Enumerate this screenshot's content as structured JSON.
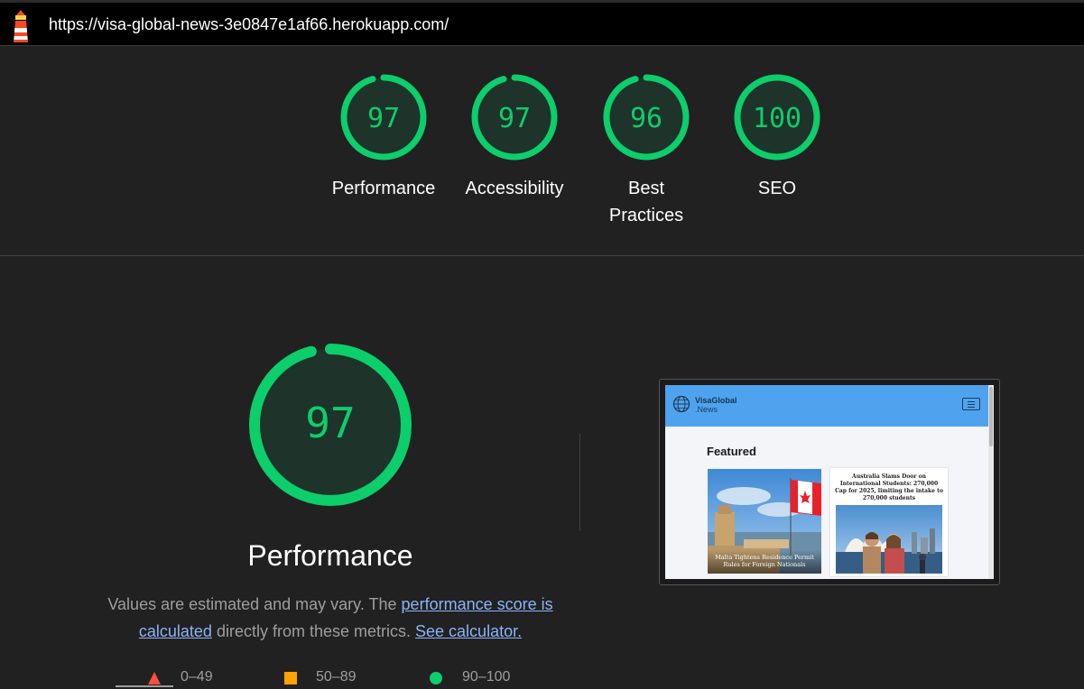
{
  "topbar": {
    "url": "https://visa-global-news-3e0847e1af66.herokuapp.com/"
  },
  "colors": {
    "pass": "#0cce6b",
    "pass_bg": "#1e3329",
    "average": "#ffa400",
    "fail": "#ff4e42",
    "link": "#8ab4f8"
  },
  "gauges": [
    {
      "score": "97",
      "value": 0.97,
      "label": "Performance"
    },
    {
      "score": "97",
      "value": 0.97,
      "label": "Accessibility"
    },
    {
      "score": "96",
      "value": 0.96,
      "label": "Best Practices"
    },
    {
      "score": "100",
      "value": 1.0,
      "label": "SEO"
    }
  ],
  "performance": {
    "score": "97",
    "value": 0.97,
    "title": "Performance",
    "desc_prefix": "Values are estimated and may vary. The ",
    "link_score": "performance score is calculated",
    "desc_middle": " directly from these metrics. ",
    "link_calc": "See calculator."
  },
  "legend": [
    {
      "icon": "triangle-icon",
      "range": "0–49"
    },
    {
      "icon": "square-icon",
      "range": "50–89"
    },
    {
      "icon": "circle-icon",
      "range": "90–100"
    }
  ],
  "screenshot": {
    "logo_line1": "VisaGlobal",
    "logo_line2": ".News",
    "featured": "Featured",
    "card1_caption": "Malta Tightens Residence Permit Rules for Foreign Nationals",
    "card2_title": "Australia Slams Door on International Students: 270,000 Cap for 2025, limiting the intake to 270,000 students"
  }
}
